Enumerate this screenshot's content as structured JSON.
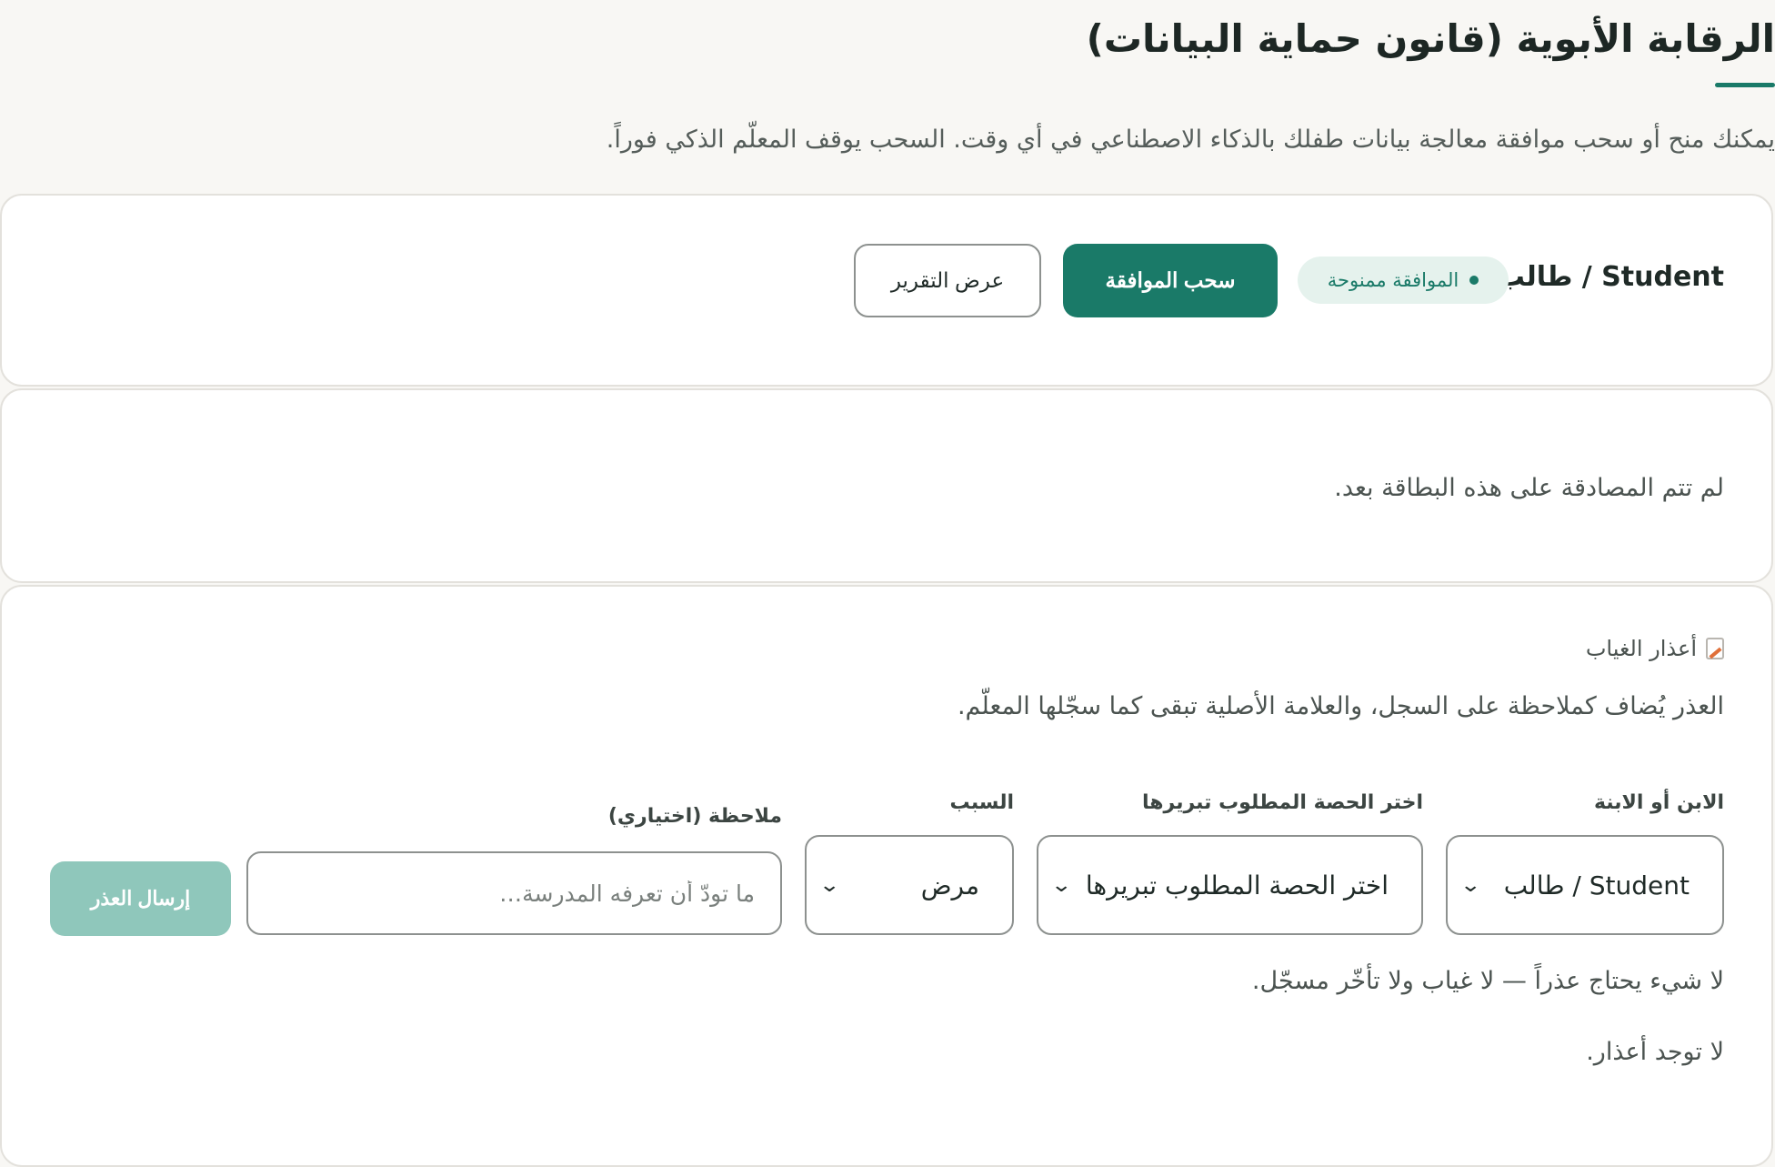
{
  "page": {
    "title": "الرقابة الأبوية (قانون حماية البيانات)",
    "intro": "يمكنك منح أو سحب موافقة معالجة بيانات طفلك بالذكاء الاصطناعي في أي وقت. السحب يوقف المعلّم الذكي فوراً."
  },
  "consent_card": {
    "student_name": "Student / طالب",
    "status_badge": "الموافقة ممنوحة",
    "withdraw_label": "سحب الموافقة",
    "report_label": "عرض التقرير",
    "accent_color": "#1a7a68"
  },
  "auth_card": {
    "message": "لم تتم المصادقة على هذه البطاقة بعد."
  },
  "excuses_card": {
    "heading": "أعذار الغياب",
    "heading_icon": "memo-icon",
    "description": "العذر يُضاف كملاحظة على السجل، والعلامة الأصلية تبقى كما سجّلها المعلّم.",
    "child_label": "الابن أو الابنة",
    "child_value": "Student / طالب",
    "session_label": "اختر الحصة المطلوب تبريرها",
    "session_value": "اختر الحصة المطلوب تبريرها",
    "reason_label": "السبب",
    "reason_value": "مرض",
    "note_label": "ملاحظة (اختياري)",
    "note_placeholder": "ما تودّ أن تعرفه المدرسة…",
    "submit_label": "إرسال العذر",
    "nothing_needed": "لا شيء يحتاج عذراً — لا غياب ولا تأخّر مسجّل.",
    "no_excuses": "لا توجد أعذار."
  }
}
